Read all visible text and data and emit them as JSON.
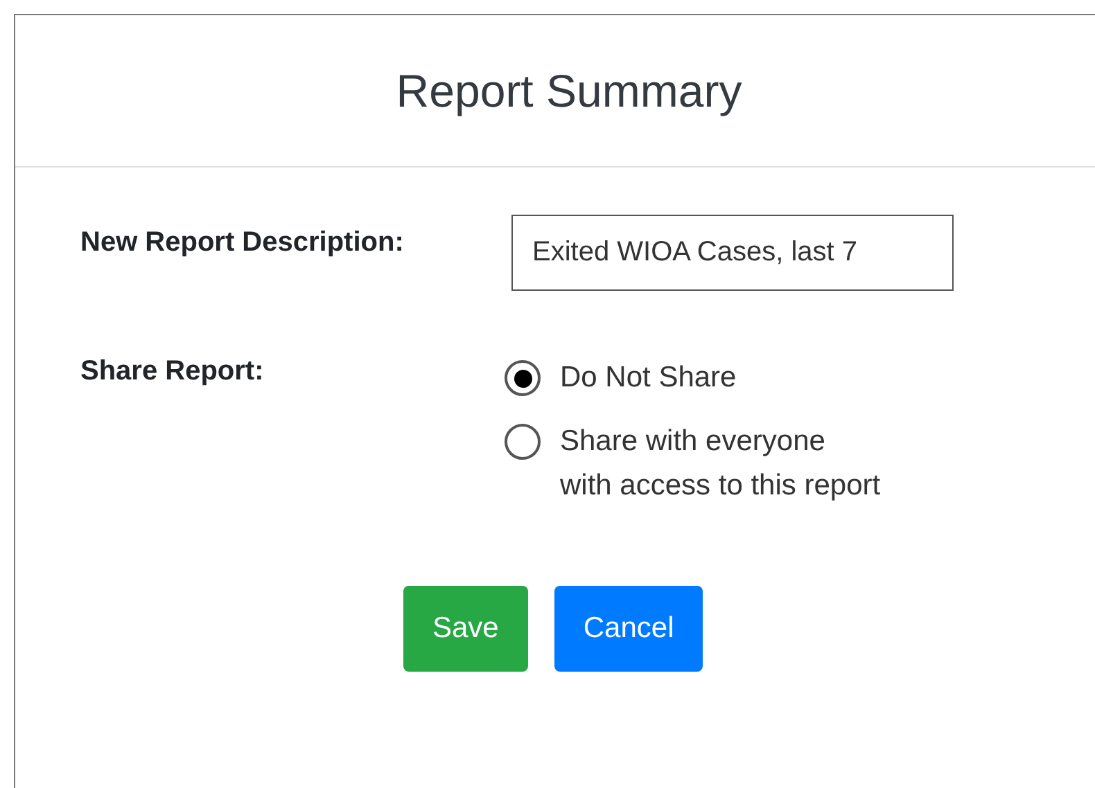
{
  "dialog": {
    "title": "Report Summary"
  },
  "description": {
    "label": "New Report Description:",
    "value": "Exited WIOA Cases, last 7"
  },
  "share": {
    "label": "Share Report:",
    "options": [
      {
        "label": "Do Not Share",
        "selected": true
      },
      {
        "label": "Share with everyone\nwith access to this report",
        "selected": false
      }
    ]
  },
  "buttons": [
    {
      "label": "Save",
      "kind": "primary"
    },
    {
      "label": "Cancel",
      "kind": "secondary"
    }
  ]
}
